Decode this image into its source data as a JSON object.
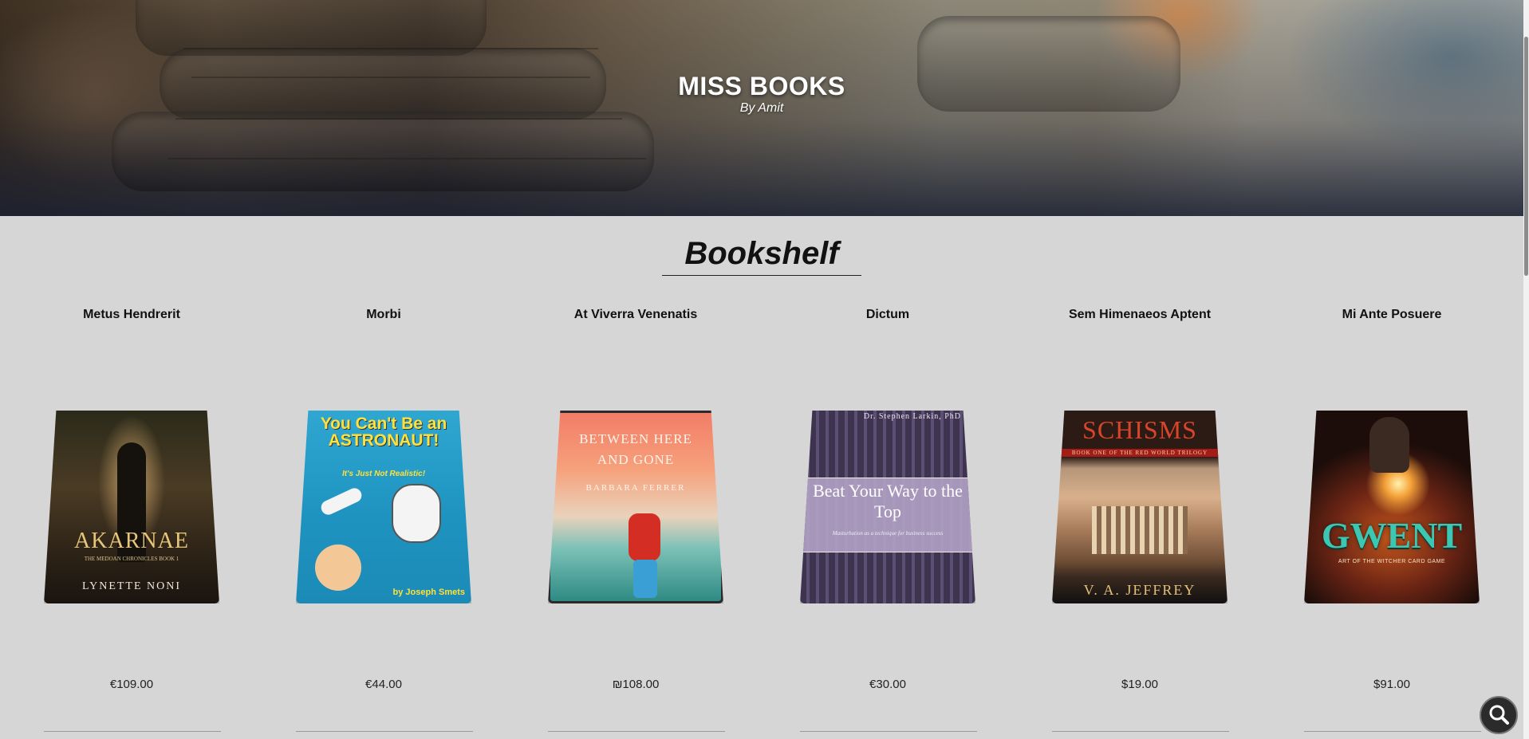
{
  "hero": {
    "title": "MISS BOOKS",
    "subtitle": "By Amit"
  },
  "section": {
    "title": "Bookshelf"
  },
  "books": [
    {
      "title": "Metus Hendrerit",
      "price": "€109.00",
      "cover": {
        "lines": [
          "AKARNAE",
          "THE MEDOAN CHRONICLES BOOK 1",
          "LYNETTE NONI"
        ]
      }
    },
    {
      "title": "Morbi",
      "price": "€44.00",
      "cover": {
        "lines": [
          "You Can't Be an ASTRONAUT!",
          "It's Just Not Realistic!",
          "by Joseph Smets"
        ]
      }
    },
    {
      "title": "At Viverra Venenatis",
      "price": "₪108.00",
      "cover": {
        "lines": [
          "BETWEEN HERE AND GONE",
          "BARBARA FERRER"
        ]
      }
    },
    {
      "title": "Dictum",
      "price": "€30.00",
      "cover": {
        "lines": [
          "Dr. Stephen Larkin, PhD",
          "Beat Your Way to the Top",
          "Masturbation as a technique for business success"
        ]
      }
    },
    {
      "title": "Sem Himenaeos Aptent",
      "price": "$19.00",
      "cover": {
        "lines": [
          "SCHISMS",
          "BOOK ONE OF THE RED WORLD TRILOGY",
          "V. A. JEFFREY"
        ]
      }
    },
    {
      "title": "Mi Ante Posuere",
      "price": "$91.00",
      "cover": {
        "lines": [
          "GWENT",
          "ART OF THE WITCHER CARD GAME"
        ]
      }
    }
  ],
  "colors": {
    "page_background": "#d6d6d6",
    "hero_text": "#ffffff"
  },
  "icons": {
    "zoom": "magnifier-icon"
  }
}
